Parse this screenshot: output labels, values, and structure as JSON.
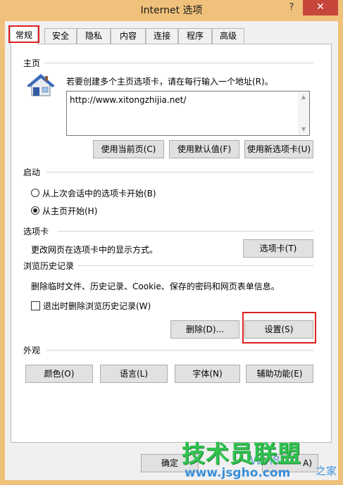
{
  "window": {
    "title": "Internet 选项",
    "help_glyph": "?",
    "close_glyph": "✕"
  },
  "tabs": [
    {
      "label": "常规",
      "active": true
    },
    {
      "label": "安全",
      "active": false
    },
    {
      "label": "隐私",
      "active": false
    },
    {
      "label": "内容",
      "active": false
    },
    {
      "label": "连接",
      "active": false
    },
    {
      "label": "程序",
      "active": false
    },
    {
      "label": "高级",
      "active": false
    }
  ],
  "homepage": {
    "heading": "主页",
    "icon": "house-icon",
    "instruction": "若要创建多个主页选项卡，请在每行输入一个地址(R)。",
    "url_value": "http://www.xitongzhijia.net/",
    "buttons": {
      "use_current": "使用当前页(C)",
      "use_default": "使用默认值(F)",
      "use_new_tab": "使用新选项卡(U)"
    }
  },
  "startup": {
    "heading": "启动",
    "options": [
      {
        "label": "从上次会话中的选项卡开始(B)",
        "selected": false
      },
      {
        "label": "从主页开始(H)",
        "selected": true
      }
    ]
  },
  "tabs_section": {
    "heading": "选项卡",
    "description": "更改网页在选项卡中的显示方式。",
    "button": "选项卡(T)"
  },
  "history": {
    "heading": "浏览历史记录",
    "description": "删除临时文件、历史记录、Cookie、保存的密码和网页表单信息。",
    "checkbox_label": "退出时删除浏览历史记录(W)",
    "checkbox_checked": false,
    "delete_button": "删除(D)...",
    "settings_button": "设置(S)"
  },
  "appearance": {
    "heading": "外观",
    "buttons": {
      "colors": "颜色(O)",
      "languages": "语言(L)",
      "fonts": "字体(N)",
      "accessibility": "辅助功能(E)"
    }
  },
  "footer": {
    "ok": "确定",
    "apply_partial": "A)"
  },
  "watermark": {
    "title": "技术员联盟",
    "url": "www.jsgho.com",
    "logo_text": "Win8",
    "side_text": "之家"
  },
  "colors": {
    "frame": "#f0c17b",
    "close": "#c7463b",
    "highlight": "#e02020",
    "watermark_green": "#2fc34f"
  }
}
